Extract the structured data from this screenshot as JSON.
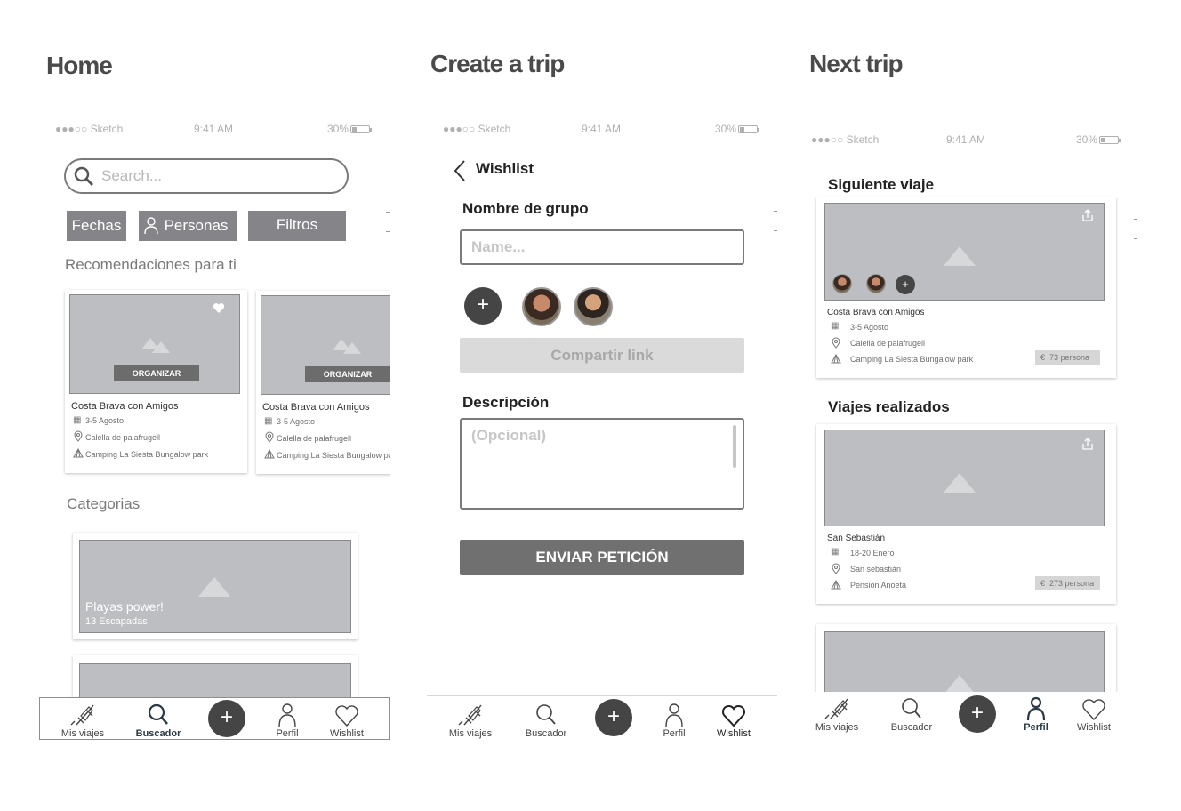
{
  "colors": {
    "accent_dark": "#454545",
    "placeholder": "#bdbec1",
    "chip": "#858589",
    "disabled": "#dadada"
  },
  "titles": {
    "home": "Home",
    "create": "Create a trip",
    "next": "Next trip"
  },
  "status": {
    "carrier": "●●●○○ Sketch",
    "time": "9:41 AM",
    "battery": "30%"
  },
  "home": {
    "search_placeholder": "Search...",
    "filters": [
      "Fechas",
      "Personas",
      "Filtros"
    ],
    "recommend_heading": "Recomendaciones para ti",
    "cards": [
      {
        "button": "ORGANIZAR",
        "title": "Costa Brava con Amigos",
        "dates": "3-5 Agosto",
        "location": "Calella de palafrugell",
        "lodging": "Camping La Siesta Bungalow park"
      },
      {
        "button": "ORGANIZAR",
        "title": "Costa Brava con Amigos",
        "dates": "3-5 Agosto",
        "location": "Calella de palafrugell",
        "lodging": "Camping La Siesta Bungalow park"
      }
    ],
    "categories_heading": "Categorias",
    "category": {
      "title": "Playas power!",
      "subtitle": "13 Escapadas"
    }
  },
  "create": {
    "back_title": "Wishlist",
    "group_label": "Nombre de grupo",
    "name_placeholder": "Name...",
    "share_label": "Compartir link",
    "desc_label": "Descripción",
    "desc_placeholder": "(Opcional)",
    "submit_label": "ENVIAR PETICIÓN"
  },
  "next": {
    "upcoming_heading": "Siguiente viaje",
    "upcoming": {
      "title": "Costa Brava con Amigos",
      "dates": "3-5 Agosto",
      "location": "Calella de palafrugell",
      "lodging": "Camping La Siesta Bungalow park",
      "price": "73 persona"
    },
    "done_heading": "Viajes realizados",
    "done": {
      "title": "San Sebastián",
      "dates": "18-20 Enero",
      "location": "San sebastián",
      "lodging": "Pensión Anoeta",
      "price": "273 persona"
    }
  },
  "tabs": {
    "home": [
      "Mis viajes",
      "Buscador",
      "Perfil",
      "Wishlist"
    ],
    "create": [
      "Mis viajes",
      "Buscador",
      "Perfil",
      "Wishlist"
    ],
    "next": [
      "Mis viajes",
      "Buscador",
      "Perfil",
      "Wishlist"
    ],
    "plus": "+"
  },
  "icons": {
    "rocket": "rocket-icon",
    "search": "search-icon",
    "person": "person-icon",
    "heart": "heart-icon",
    "calendar": "calendar-icon",
    "pin": "pin-icon",
    "tent": "tent-icon",
    "share": "share-icon",
    "euro": "€"
  }
}
